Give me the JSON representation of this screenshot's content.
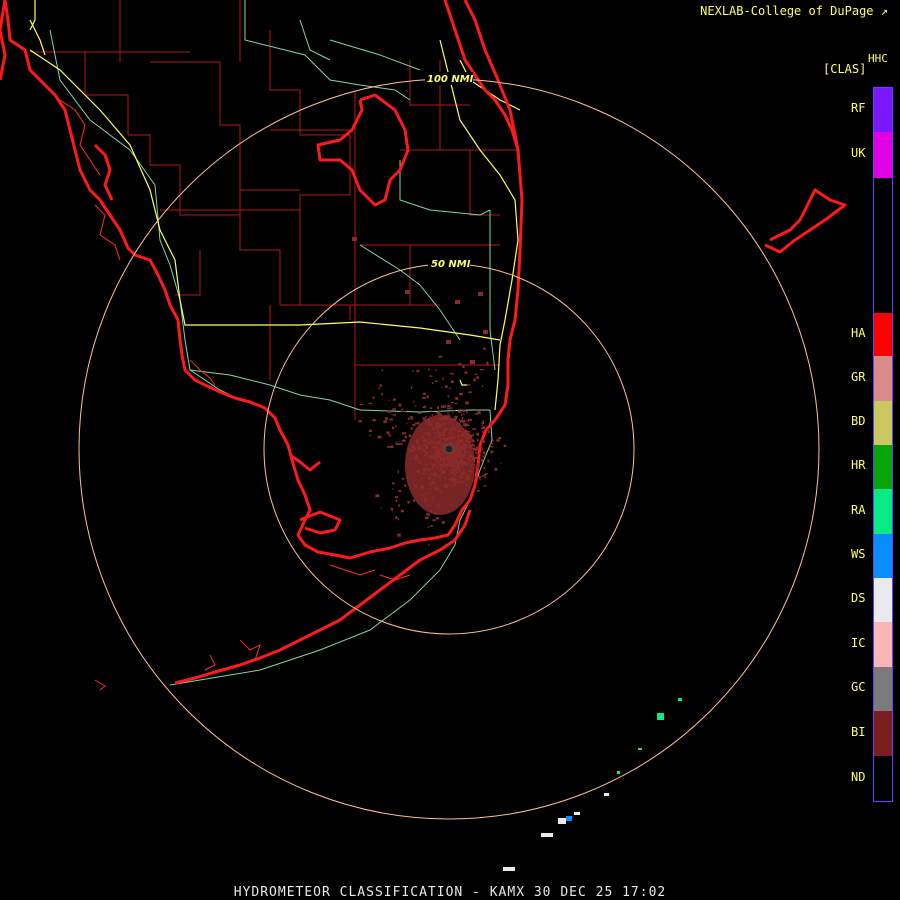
{
  "header": {
    "credit": "NEXLAB-College of DuPage",
    "credit_icon": "pointer-arrow-icon",
    "product": "HHC",
    "product_sub": "[CLAS]"
  },
  "map": {
    "range_rings": [
      "100 NMI",
      "50 NMI"
    ],
    "colors": {
      "coast": "#ff1a1a",
      "county": "#b01818",
      "highway": "#ffff55",
      "road": "#7fd6a0",
      "ring": "#ffc090",
      "echo": "#8b2a2a"
    }
  },
  "legend": [
    {
      "code": "RF",
      "color": "#7a17ff"
    },
    {
      "code": "UK",
      "color": "#e100e6"
    },
    {
      "code": "HA",
      "color": "#ff0000"
    },
    {
      "code": "GR",
      "color": "#d98a8a"
    },
    {
      "code": "BD",
      "color": "#c8c760"
    },
    {
      "code": "HR",
      "color": "#07a40a"
    },
    {
      "code": "RA",
      "color": "#07ea86"
    },
    {
      "code": "WS",
      "color": "#0a8cff"
    },
    {
      "code": "DS",
      "color": "#e9e9ee"
    },
    {
      "code": "IC",
      "color": "#fcb5b5"
    },
    {
      "code": "GC",
      "color": "#7a7a7a"
    },
    {
      "code": "BI",
      "color": "#7a1f1f"
    },
    {
      "code": "ND",
      "color": "#000000"
    }
  ],
  "footer": {
    "title": "HYDROMETEOR CLASSIFICATION - KAMX 30 DEC 25 17:02"
  }
}
